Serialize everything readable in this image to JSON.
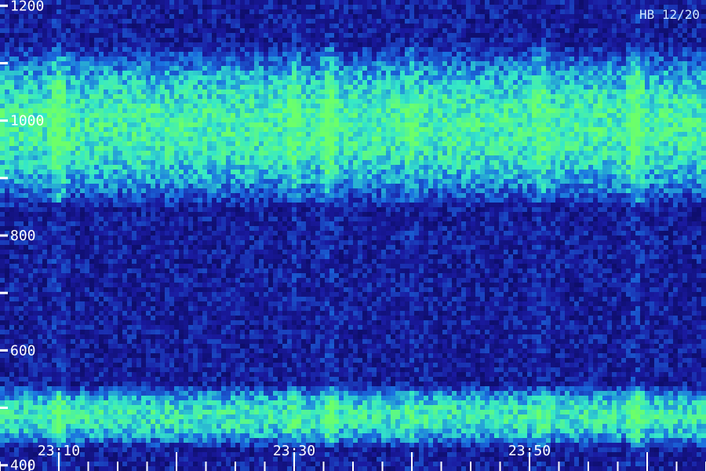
{
  "chart_data": {
    "type": "heatmap",
    "stamp": "HB 12/20",
    "y_axis": {
      "range": [
        390,
        1210
      ],
      "tick_labels": [
        {
          "value": 1200,
          "text": "1200"
        },
        {
          "value": 1000,
          "text": "1000"
        },
        {
          "value": 800,
          "text": "800"
        },
        {
          "value": 600,
          "text": "600"
        },
        {
          "value": 400,
          "text": "400"
        }
      ],
      "tick_step": 100
    },
    "x_axis": {
      "range": [
        "23:05",
        "24:05"
      ],
      "tick_labels": [
        {
          "value": "23:10",
          "text": "23:10"
        },
        {
          "value": "23:30",
          "text": "23:30"
        },
        {
          "value": "23:50",
          "text": "23:50"
        }
      ],
      "minor_step_minutes": 2.5,
      "major_step_minutes": 10
    },
    "bands": [
      {
        "low": 900,
        "high": 1080,
        "intensity": 0.62
      },
      {
        "low": 450,
        "high": 520,
        "intensity": 0.58
      }
    ],
    "bright_columns": [
      {
        "time": "23:10",
        "strength": 0.9
      },
      {
        "time": "23:30",
        "strength": 0.5
      },
      {
        "time": "23:33",
        "strength": 0.85
      },
      {
        "time": "23:40",
        "strength": 0.45
      },
      {
        "time": "23:51",
        "strength": 0.6
      },
      {
        "time": "23:59",
        "strength": 1.0
      }
    ],
    "colors": {
      "background": "#0b0b60",
      "low": "#1a1aa0",
      "mid": "#1a6fe0",
      "high": "#35e8c8",
      "peak": "#6cff6a",
      "axis": "#ffffff"
    }
  }
}
